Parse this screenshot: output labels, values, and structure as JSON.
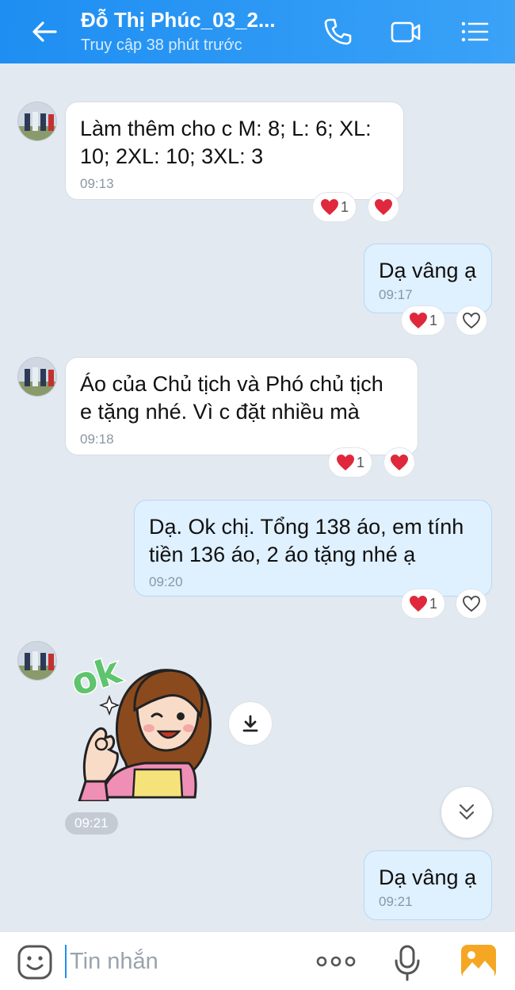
{
  "header": {
    "title": "Đỗ Thị Phúc_03_2...",
    "subtitle": "Truy cập 38 phút trước"
  },
  "messages": [
    {
      "sender": "in",
      "text_lines": [
        "Làm thêm cho c M: 8; L: 6; XL:",
        "10; 2XL: 10; 3XL: 3"
      ],
      "time": "09:13",
      "reaction_count": "1"
    },
    {
      "sender": "out",
      "text_lines": [
        "Dạ vâng ạ"
      ],
      "time": "09:17",
      "reaction_count": "1"
    },
    {
      "sender": "in",
      "text_lines": [
        "Áo của Chủ tịch và Phó chủ tịch",
        "e tặng nhé. Vì c đặt nhiều mà"
      ],
      "time": "09:18",
      "reaction_count": "1"
    },
    {
      "sender": "out",
      "text_lines": [
        "Dạ. Ok chị. Tổng 138 áo, em tính",
        "tiền 136 áo, 2 áo tặng nhé ạ"
      ],
      "time": "09:20",
      "reaction_count": "1"
    },
    {
      "sender": "in",
      "type": "sticker",
      "sticker_text": "ok",
      "time": "09:21"
    },
    {
      "sender": "out",
      "text_lines": [
        "Dạ vâng ạ"
      ],
      "time": "09:21"
    }
  ],
  "input": {
    "placeholder": "Tin nhắn"
  },
  "colors": {
    "header": "#1e8ef2",
    "background": "#e2e9f1",
    "incoming_bubble": "#ffffff",
    "outgoing_bubble": "#dff0ff",
    "heart": "#e0283c"
  },
  "icons": [
    "back-arrow-icon",
    "phone-icon",
    "video-call-icon",
    "menu-icon",
    "heart-icon",
    "heart-outline-icon",
    "download-icon",
    "chevron-double-down-icon",
    "emoji-icon",
    "more-icon",
    "microphone-icon",
    "image-icon"
  ]
}
